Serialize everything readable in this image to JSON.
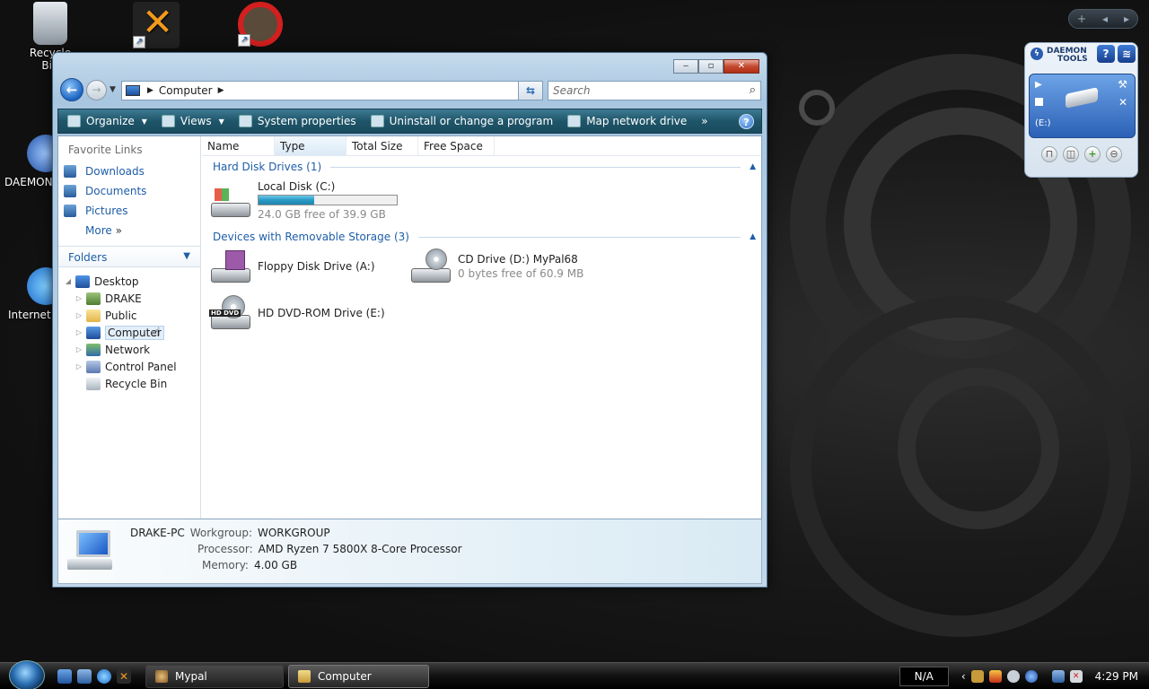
{
  "desktop": {
    "icons": [
      {
        "label": "Recycle Bin",
        "id": "recycle"
      },
      {
        "label": "",
        "id": "chat"
      },
      {
        "label": "",
        "id": "noentry"
      },
      {
        "label": "DAEMON Tools Lite",
        "id": "daemon"
      },
      {
        "label": "Internet Explorer",
        "id": "ie"
      }
    ]
  },
  "explorer": {
    "title_buttons": {
      "minimize": "‒",
      "maximize": "▫",
      "close": "✕"
    },
    "address": {
      "segments": [
        "Computer"
      ]
    },
    "search": {
      "placeholder": "Search"
    },
    "toolbar": {
      "organize": "Organize",
      "views": "Views",
      "system_properties": "System properties",
      "uninstall": "Uninstall or change a program",
      "map_drive": "Map network drive",
      "more": "»"
    },
    "nav": {
      "favorite_links_heading": "Favorite Links",
      "favorites": [
        "Downloads",
        "Documents",
        "Pictures"
      ],
      "more": "More",
      "folders_heading": "Folders",
      "tree": [
        {
          "label": "Desktop",
          "level": 0,
          "expanded": true
        },
        {
          "label": "DRAKE",
          "level": 1
        },
        {
          "label": "Public",
          "level": 1
        },
        {
          "label": "Computer",
          "level": 1,
          "selected": true
        },
        {
          "label": "Network",
          "level": 1
        },
        {
          "label": "Control Panel",
          "level": 1
        },
        {
          "label": "Recycle Bin",
          "level": 1
        }
      ]
    },
    "columns": [
      "Name",
      "Type",
      "Total Size",
      "Free Space"
    ],
    "sorted_column": "Type",
    "groups": {
      "hdd": {
        "title": "Hard Disk Drives (1)"
      },
      "removable": {
        "title": "Devices with Removable Storage (3)"
      }
    },
    "drives": {
      "c": {
        "name": "Local Disk (C:)",
        "free_text": "24.0 GB free of 39.9 GB",
        "used_fraction": 0.4
      },
      "a": {
        "name": "Floppy Disk Drive (A:)"
      },
      "d": {
        "name": "CD Drive (D:) MyPal68",
        "free_text": "0 bytes free of 60.9 MB"
      },
      "e": {
        "name": "HD DVD-ROM Drive (E:)",
        "badge": "HD DVD"
      }
    },
    "details": {
      "computer_name": "DRAKE-PC",
      "workgroup_label": "Workgroup:",
      "workgroup": "WORKGROUP",
      "processor_label": "Processor:",
      "processor": "AMD Ryzen 7 5800X 8-Core Processor",
      "memory_label": "Memory:",
      "memory": "4.00 GB"
    }
  },
  "daemon_gadget": {
    "logo_line1": "DAEMON",
    "logo_line2": "TOOLS",
    "drive": "(E:)",
    "help": "?"
  },
  "taskbar": {
    "buttons": [
      "Mypal",
      "Computer"
    ],
    "na": "N/A",
    "time": "4:29 PM"
  }
}
